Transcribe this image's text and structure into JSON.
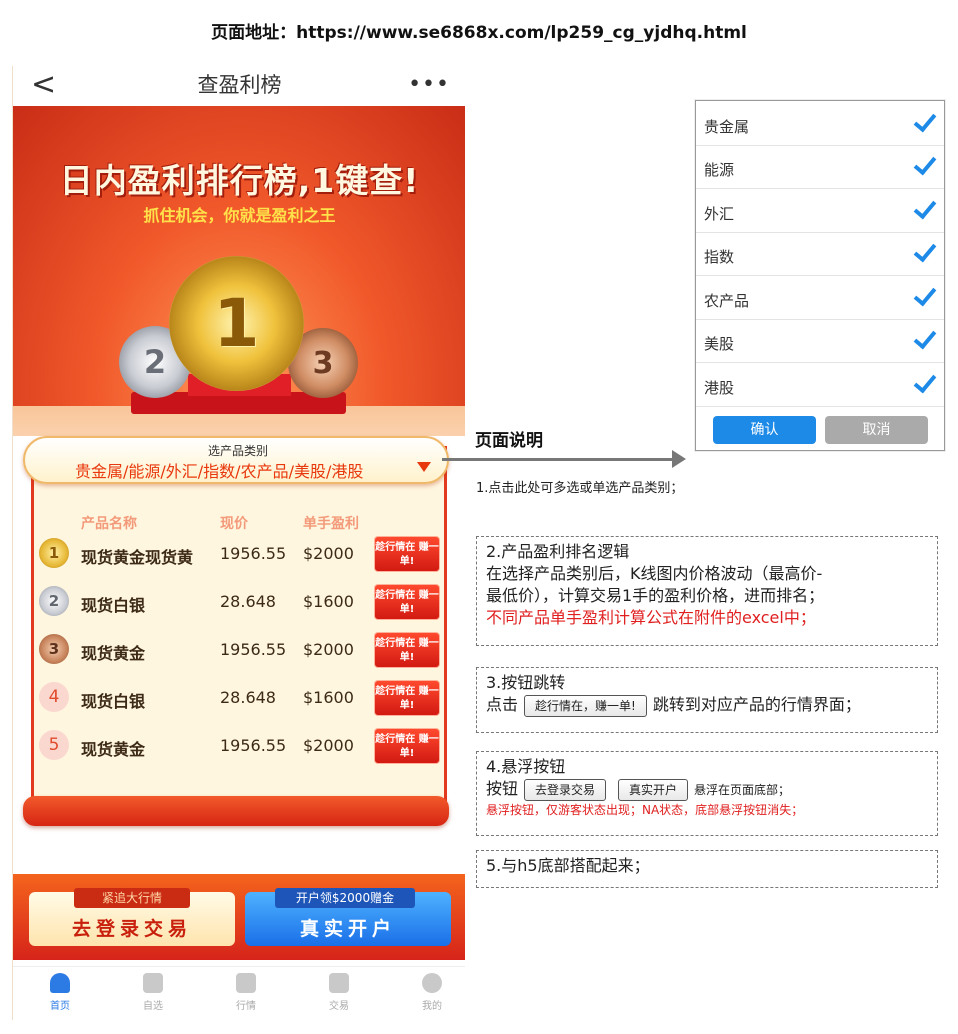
{
  "page_url": "页面地址：https://www.se6868x.com/lp259_cg_yjdhq.html",
  "navbar": {
    "back": "<",
    "title": "查盈利榜",
    "more": "•••"
  },
  "hero": {
    "title": "日内盈利排行榜,1键查!",
    "subtitle": "抓住机会，你就是盈利之王",
    "medals": [
      "1",
      "2",
      "3"
    ]
  },
  "selector": {
    "hint": "选产品类别",
    "value": "贵金属/能源/外汇/指数/农产品/美股/港股"
  },
  "table": {
    "headers": [
      "产品名称",
      "现价",
      "单手盈利"
    ],
    "button_label": "趁行情在 赚一单!",
    "rows": [
      {
        "rank": "1",
        "name": "现货黄金现货黄",
        "price": "1956.55",
        "profit": "$2000"
      },
      {
        "rank": "2",
        "name": "现货白银",
        "price": "28.648",
        "profit": "$1600"
      },
      {
        "rank": "3",
        "name": "现货黄金",
        "price": "1956.55",
        "profit": "$2000"
      },
      {
        "rank": "4",
        "name": "现货白银",
        "price": "28.648",
        "profit": "$1600"
      },
      {
        "rank": "5",
        "name": "现货黄金",
        "price": "1956.55",
        "profit": "$2000"
      }
    ]
  },
  "float_buttons": {
    "login": {
      "tag": "紧追大行情",
      "label": "去登录交易"
    },
    "real": {
      "tag": "开户领$2000赠金",
      "label": "真实开户"
    }
  },
  "tabbar": [
    {
      "label": "首页",
      "icon": "home-icon",
      "active": true
    },
    {
      "label": "自选",
      "icon": "bookmark-icon",
      "active": false
    },
    {
      "label": "行情",
      "icon": "chart-icon",
      "active": false
    },
    {
      "label": "交易",
      "icon": "trade-icon",
      "active": false
    },
    {
      "label": "我的",
      "icon": "user-icon",
      "active": false
    }
  ],
  "checklist": {
    "items": [
      "贵金属",
      "能源",
      "外汇",
      "指数",
      "农产品",
      "美股",
      "港股"
    ],
    "confirm": "确认",
    "cancel": "取消"
  },
  "description": {
    "title": "页面说明",
    "note1": "1.点击此处可多选或单选产品类别；",
    "box2": {
      "title": "2.产品盈利排名逻辑",
      "line1": "在选择产品类别后，K线图内价格波动（最高价-",
      "line2": "最低价），计算交易1手的盈利价格，进而排名；",
      "red": "不同产品单手盈利计算公式在附件的excel中；"
    },
    "box3": {
      "title": "3.按钮跳转",
      "prefix": "点击",
      "button": "趁行情在，赚一单!",
      "suffix": "跳转到对应产品的行情界面；"
    },
    "box4": {
      "title": "4.悬浮按钮",
      "prefix": "按钮",
      "btn1": "去登录交易",
      "btn2": "真实开户",
      "suffix": "悬浮在页面底部；",
      "red": "悬浮按钮，仅游客状态出现；NA状态，底部悬浮按钮消失；"
    },
    "box5": {
      "title": "5.与h5底部搭配起来；"
    }
  },
  "colors": {
    "accent": "#e8380d",
    "blue": "#1e8ae8",
    "tab_active": "#2c7be5"
  }
}
